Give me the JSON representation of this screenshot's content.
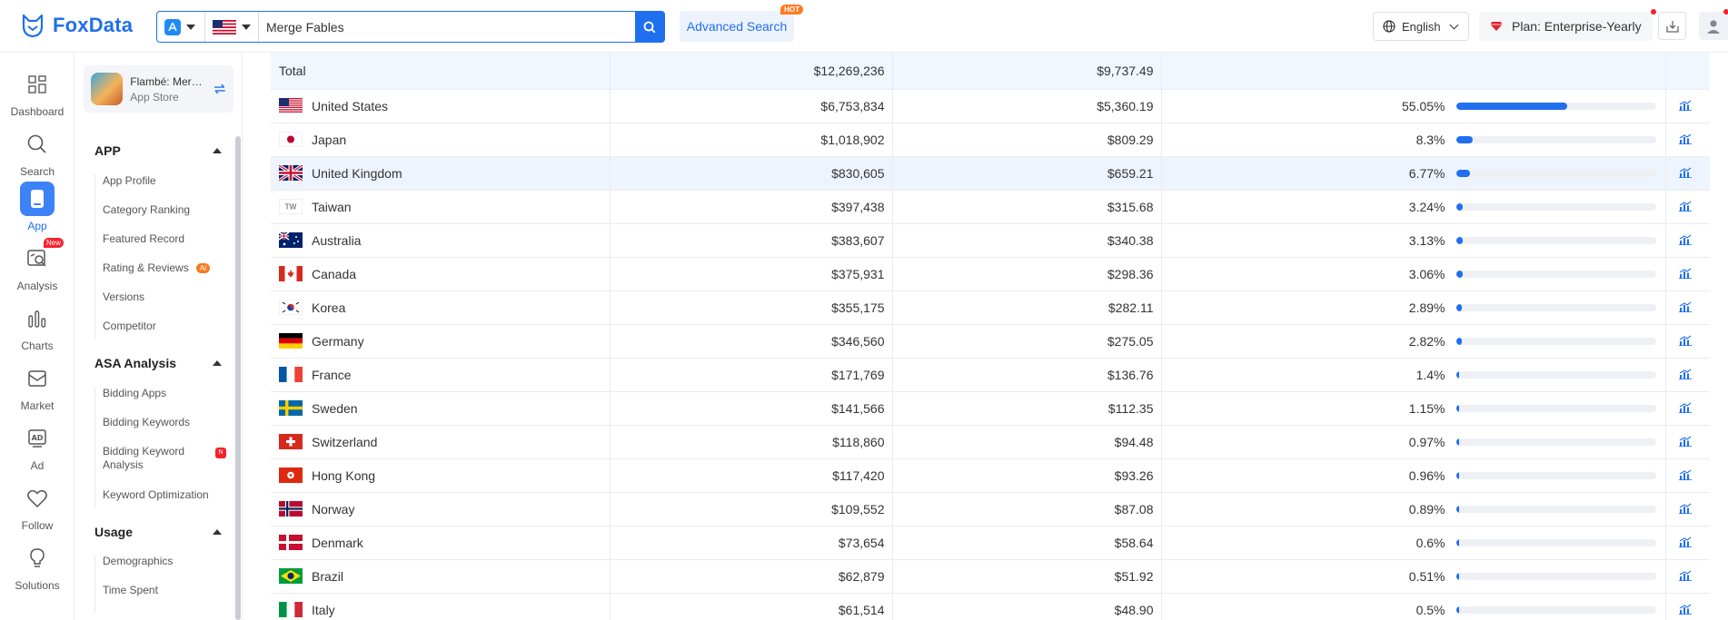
{
  "header": {
    "brand": "FoxData",
    "search_value": "Merge Fables",
    "advanced_search_label": "Advanced Search",
    "hot_badge": "HOT",
    "language": "English",
    "plan": "Plan: Enterprise-Yearly",
    "accent": "#1f6ff0"
  },
  "rail": [
    {
      "label": "Dashboard",
      "icon": "dashboard-icon"
    },
    {
      "label": "Search",
      "icon": "search-icon"
    },
    {
      "label": "App",
      "icon": "app-icon"
    },
    {
      "label": "Analysis",
      "icon": "analysis-icon",
      "badge": "New"
    },
    {
      "label": "Charts",
      "icon": "charts-icon"
    },
    {
      "label": "Market",
      "icon": "market-icon"
    },
    {
      "label": "Ad",
      "icon": "ad-icon"
    },
    {
      "label": "Follow",
      "icon": "follow-heart-icon"
    },
    {
      "label": "Solutions",
      "icon": "lightbulb-icon"
    }
  ],
  "app_card": {
    "name": "Flambé: Merg...",
    "store": "App Store"
  },
  "sections": [
    {
      "title": "APP",
      "items": [
        "App Profile",
        "Category Ranking",
        "Featured Record",
        "Rating & Reviews",
        "Versions",
        "Competitor"
      ],
      "ai_badge": "AI"
    },
    {
      "title": "ASA Analysis",
      "items": [
        "Bidding Apps",
        "Bidding Keywords",
        "Bidding Keyword Analysis",
        "Keyword Optimization"
      ],
      "n_badge": "N"
    },
    {
      "title": "Usage",
      "items": [
        "Demographics",
        "Time Spent"
      ]
    }
  ],
  "table": {
    "total": {
      "label": "Total",
      "revenue": "$12,269,236",
      "downloads": "$9,737.49"
    },
    "rows": [
      {
        "country": "United States",
        "flag": "us",
        "revenue": "$6,753,834",
        "second": "$5,360.19",
        "share_label": "55.05%",
        "share": 0.5505
      },
      {
        "country": "Japan",
        "flag": "jp",
        "revenue": "$1,018,902",
        "second": "$809.29",
        "share_label": "8.3%",
        "share": 0.083
      },
      {
        "country": "United Kingdom",
        "flag": "gb",
        "revenue": "$830,605",
        "second": "$659.21",
        "share_label": "6.77%",
        "share": 0.0677
      },
      {
        "country": "Taiwan",
        "flag": "tw",
        "flag_text": "TW",
        "revenue": "$397,438",
        "second": "$315.68",
        "share_label": "3.24%",
        "share": 0.0324
      },
      {
        "country": "Australia",
        "flag": "au",
        "revenue": "$383,607",
        "second": "$340.38",
        "share_label": "3.13%",
        "share": 0.0313
      },
      {
        "country": "Canada",
        "flag": "ca",
        "revenue": "$375,931",
        "second": "$298.36",
        "share_label": "3.06%",
        "share": 0.0306
      },
      {
        "country": "Korea",
        "flag": "kr",
        "revenue": "$355,175",
        "second": "$282.11",
        "share_label": "2.89%",
        "share": 0.0289
      },
      {
        "country": "Germany",
        "flag": "de",
        "revenue": "$346,560",
        "second": "$275.05",
        "share_label": "2.82%",
        "share": 0.0282
      },
      {
        "country": "France",
        "flag": "fr",
        "revenue": "$171,769",
        "second": "$136.76",
        "share_label": "1.4%",
        "share": 0.014
      },
      {
        "country": "Sweden",
        "flag": "se",
        "revenue": "$141,566",
        "second": "$112.35",
        "share_label": "1.15%",
        "share": 0.0115
      },
      {
        "country": "Switzerland",
        "flag": "ch",
        "revenue": "$118,860",
        "second": "$94.48",
        "share_label": "0.97%",
        "share": 0.0097
      },
      {
        "country": "Hong Kong",
        "flag": "hk",
        "revenue": "$117,420",
        "second": "$93.26",
        "share_label": "0.96%",
        "share": 0.0096
      },
      {
        "country": "Norway",
        "flag": "no",
        "revenue": "$109,552",
        "second": "$87.08",
        "share_label": "0.89%",
        "share": 0.0089
      },
      {
        "country": "Denmark",
        "flag": "dk",
        "revenue": "$73,654",
        "second": "$58.64",
        "share_label": "0.6%",
        "share": 0.006
      },
      {
        "country": "Brazil",
        "flag": "br",
        "revenue": "$62,879",
        "second": "$51.92",
        "share_label": "0.51%",
        "share": 0.0051
      },
      {
        "country": "Italy",
        "flag": "it",
        "revenue": "$61,514",
        "second": "$48.90",
        "share_label": "0.5%",
        "share": 0.005
      }
    ]
  }
}
